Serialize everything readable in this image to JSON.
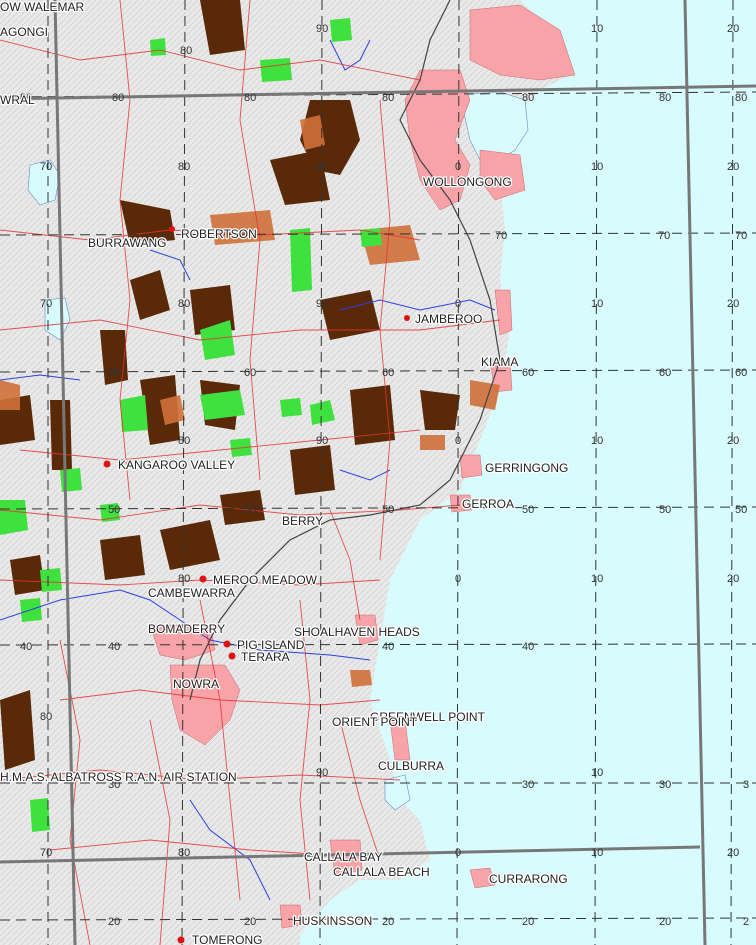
{
  "colors": {
    "sea": "#d8fbfd",
    "land": "#f1f1f1",
    "urban": "#f7a3a8",
    "road": "#e63333",
    "water_line": "#2f3fe0",
    "forest_dark": "#5a2a08",
    "forest_mid": "#d0703a",
    "vegetation_green": "#3ee13e",
    "grid": "#333333",
    "town_marker": "#e01010"
  },
  "places": [
    {
      "id": "walemar",
      "name": "OW WALEMAR"
    },
    {
      "id": "gongi",
      "name": "AGONGI"
    },
    {
      "id": "wral",
      "name": "WRAL"
    },
    {
      "id": "wollongong",
      "name": "WOLLONGONG"
    },
    {
      "id": "burrawang",
      "name": "BURRAWANG"
    },
    {
      "id": "robertson",
      "name": "ROBERTSON"
    },
    {
      "id": "jamberoo",
      "name": "JAMBEROO"
    },
    {
      "id": "kiama",
      "name": "KIAMA"
    },
    {
      "id": "kangaroo-valley",
      "name": "KANGAROO VALLEY"
    },
    {
      "id": "gerringong",
      "name": "GERRINGONG"
    },
    {
      "id": "gerroa",
      "name": "GERROA"
    },
    {
      "id": "berry",
      "name": "BERRY"
    },
    {
      "id": "meroo-meadow",
      "name": "MEROO MEADOW"
    },
    {
      "id": "cambewarra",
      "name": "CAMBEWARRA"
    },
    {
      "id": "shoalhaven-heads",
      "name": "SHOALHAVEN HEADS"
    },
    {
      "id": "bomaderry",
      "name": "BOMADERRY"
    },
    {
      "id": "pig-island",
      "name": "PIG ISLAND"
    },
    {
      "id": "terara",
      "name": "TERARA"
    },
    {
      "id": "nowra",
      "name": "NOWRA"
    },
    {
      "id": "greenwell-point",
      "name": "GREENWELL POINT"
    },
    {
      "id": "orient-point",
      "name": "ORIENT POINT"
    },
    {
      "id": "albatross",
      "name": "H.M.A.S. ALBATROSS R.A.N. AIR STATION"
    },
    {
      "id": "culburra",
      "name": "CULBURRA"
    },
    {
      "id": "callala-bay",
      "name": "CALLALA BAY"
    },
    {
      "id": "callala-beach",
      "name": "CALLALA BEACH"
    },
    {
      "id": "currarong",
      "name": "CURRARONG"
    },
    {
      "id": "huskinsson",
      "name": "HUSKINSSON"
    },
    {
      "id": "tomerong",
      "name": "TOMERONG"
    }
  ],
  "grid_labels": {
    "row80": [
      "80",
      "80",
      "80",
      "80",
      "80",
      "80"
    ],
    "row70": [
      "70",
      "70",
      "70"
    ],
    "row60": [
      "60",
      "60",
      "60",
      "60"
    ],
    "row50": [
      "50",
      "50",
      "50",
      "50"
    ],
    "row40": [
      "40",
      "40",
      "40"
    ],
    "row30": [
      "30",
      "30",
      "30",
      "3"
    ],
    "row20": [
      "20",
      "20",
      "20",
      "20",
      "2"
    ],
    "col_top": [
      "80",
      "90",
      "10",
      "20"
    ],
    "col_90": [
      "80",
      "90",
      "0",
      "10",
      "20"
    ],
    "col_70": [
      "70",
      "80",
      "90",
      "0",
      "10",
      "20"
    ],
    "col_60": [
      "60",
      "60",
      "60",
      "60"
    ],
    "col_80b": [
      "80",
      "90",
      "0",
      "10",
      "20"
    ],
    "col_50": [
      "50",
      "50",
      "50"
    ],
    "col_80c": [
      "80",
      "0",
      "10",
      "20"
    ],
    "col_70b": [
      "70",
      "80",
      "0",
      "10",
      "20"
    ],
    "misc": [
      "90",
      "90",
      "10",
      "0",
      "80",
      "90",
      "10",
      "90"
    ]
  }
}
